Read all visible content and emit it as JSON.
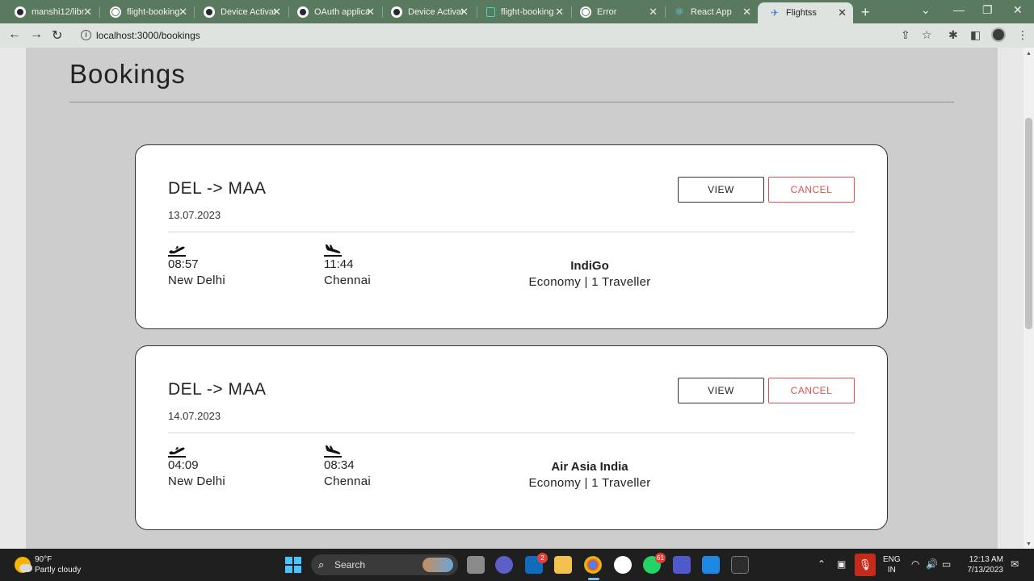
{
  "browser": {
    "tabs": [
      {
        "title": "manshi12/libr",
        "icon": "github-icon"
      },
      {
        "title": "flight-booking",
        "icon": "globe-icon"
      },
      {
        "title": "Device Activat",
        "icon": "github-icon"
      },
      {
        "title": "OAuth applica",
        "icon": "github-icon"
      },
      {
        "title": "Device Activat",
        "icon": "github-icon"
      },
      {
        "title": "flight-booking",
        "icon": "document-icon"
      },
      {
        "title": "Error",
        "icon": "globe-icon"
      },
      {
        "title": "React App",
        "icon": "react-icon"
      },
      {
        "title": "Flightss",
        "icon": "plane-icon",
        "active": true
      }
    ],
    "url": "localhost:3000/bookings"
  },
  "page": {
    "title": "Bookings",
    "bookings": [
      {
        "route": "DEL -> MAA",
        "date": "13.07.2023",
        "view_label": "VIEW",
        "cancel_label": "CANCEL",
        "departure": {
          "time": "08:57",
          "city": "New Delhi",
          "icon": "takeoff-icon"
        },
        "arrival": {
          "time": "11:44",
          "city": "Chennai",
          "icon": "landing-icon"
        },
        "airline": "IndiGo",
        "class_info": "Economy | 1 Traveller"
      },
      {
        "route": "DEL -> MAA",
        "date": "14.07.2023",
        "view_label": "VIEW",
        "cancel_label": "CANCEL",
        "departure": {
          "time": "04:09",
          "city": "New Delhi",
          "icon": "takeoff-icon"
        },
        "arrival": {
          "time": "08:34",
          "city": "Chennai",
          "icon": "landing-icon"
        },
        "airline": "Air Asia India",
        "class_info": "Economy | 1 Traveller"
      }
    ]
  },
  "taskbar": {
    "weather": {
      "temp": "90°F",
      "condition": "Partly cloudy"
    },
    "search_label": "Search",
    "badges": {
      "mail": "2",
      "whatsapp": "61"
    },
    "lang": {
      "line1": "ENG",
      "line2": "IN"
    },
    "clock": {
      "time": "12:13 AM",
      "date": "7/13/2023"
    }
  },
  "colors": {
    "tabbar": "#5a7a5f",
    "toolbar": "#dfe3e0",
    "page_bg": "#cdcdcd",
    "cancel": "#d9534f"
  }
}
